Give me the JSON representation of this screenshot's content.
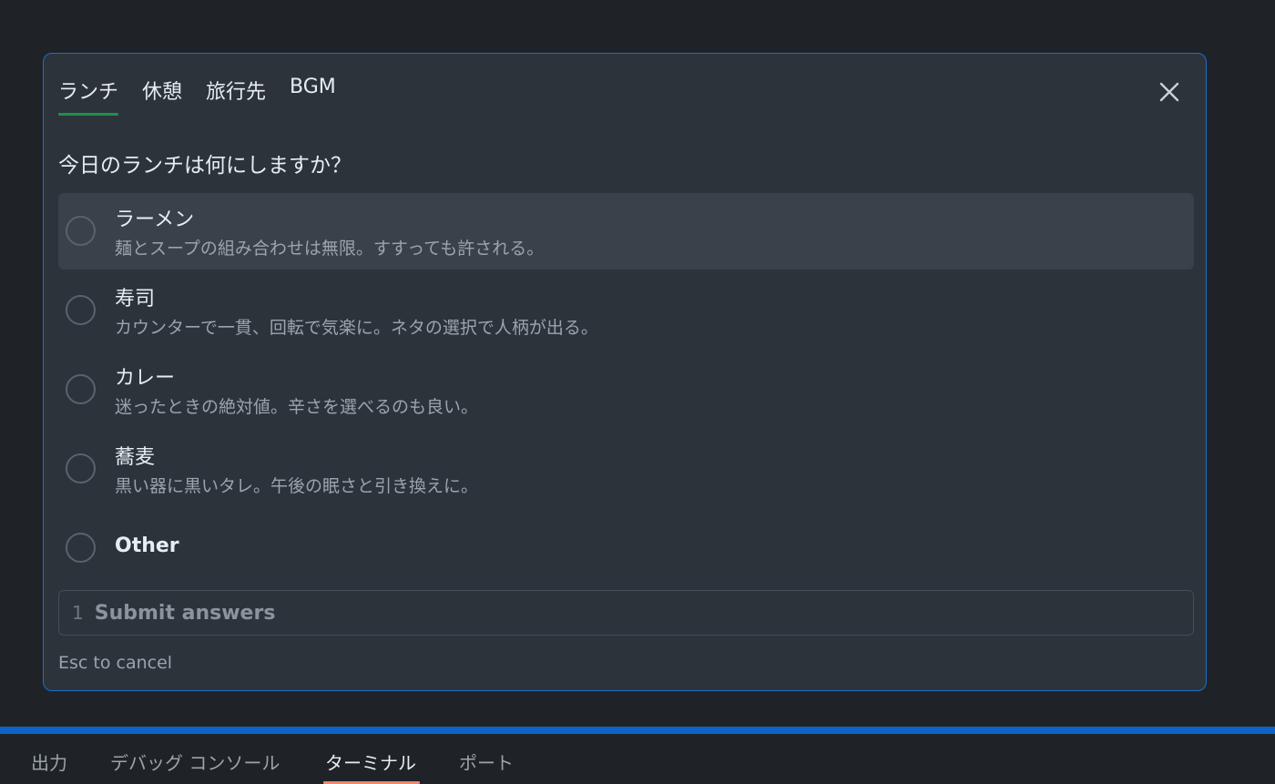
{
  "dialog": {
    "tabs": [
      {
        "label": "ランチ",
        "active": true
      },
      {
        "label": "休憩",
        "active": false
      },
      {
        "label": "旅行先",
        "active": false
      },
      {
        "label": "BGM",
        "active": false
      }
    ],
    "close_icon": "close-icon",
    "question": "今日のランチは何にしますか？",
    "options": [
      {
        "label": "ラーメン",
        "description": "麺とスープの組み合わせは無限。すすっても許される。"
      },
      {
        "label": "寿司",
        "description": "カウンターで一貫、回転で気楽に。ネタの選択で人柄が出る。"
      },
      {
        "label": "カレー",
        "description": "迷ったときの絶対値。辛さを選べるのも良い。"
      },
      {
        "label": "蕎麦",
        "description": "黒い器に黒いタレ。午後の眠さと引き換えに。"
      },
      {
        "label": "Other"
      }
    ],
    "submit": {
      "number": "1",
      "label": "Submit answers"
    },
    "esc_hint": "Esc to cancel"
  },
  "panel": {
    "tabs": [
      {
        "label": "出力",
        "active": false
      },
      {
        "label": "デバッグ コンソール",
        "active": false
      },
      {
        "label": "ターミナル",
        "active": true
      },
      {
        "label": "ポート",
        "active": false
      }
    ]
  },
  "colors": {
    "background": "#1f2328",
    "dialog_bg": "#2d333b",
    "dialog_border": "#1f6fc4",
    "active_tab_underline": "#1e8f4e",
    "panel_bar": "#0e63c7",
    "panel_active_underline": "#f0876a"
  }
}
